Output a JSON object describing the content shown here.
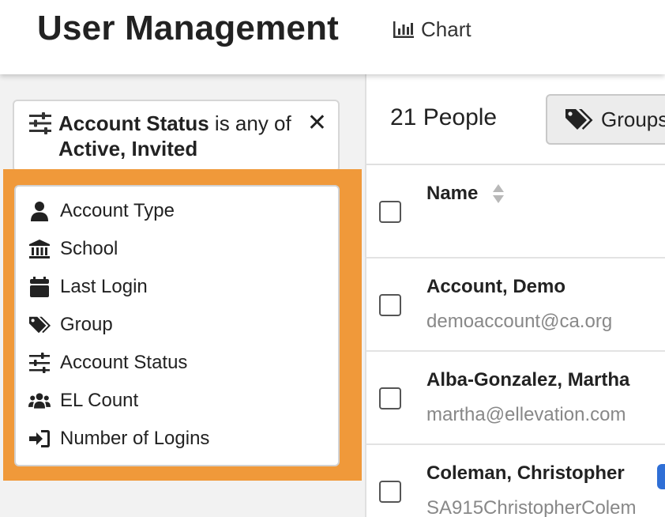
{
  "header": {
    "title": "User Management",
    "chart_label": "Chart"
  },
  "filter": {
    "field": "Account Status",
    "operator": " is any of",
    "values": "Active, Invited",
    "close_glyph": "✕"
  },
  "menu": {
    "items": [
      {
        "label": "Account Type",
        "icon": "user-icon"
      },
      {
        "label": "School",
        "icon": "school-icon"
      },
      {
        "label": "Last Login",
        "icon": "calendar-icon"
      },
      {
        "label": "Group",
        "icon": "tags-icon"
      },
      {
        "label": "Account Status",
        "icon": "sliders-icon"
      },
      {
        "label": "EL Count",
        "icon": "users-icon"
      },
      {
        "label": "Number of Logins",
        "icon": "sign-in-icon"
      }
    ]
  },
  "people": {
    "count_label": "21 People",
    "groups_label": "Groups",
    "name_header": "Name",
    "rows": [
      {
        "name": "Account, Demo",
        "email": "demoaccount@ca.org"
      },
      {
        "name": "Alba-Gonzalez, Martha",
        "email": "martha@ellevation.com"
      },
      {
        "name": "Coleman, Christopher",
        "email": "SA915ChristopherColem"
      }
    ]
  },
  "colors": {
    "highlight": "#f0993a",
    "badge": "#2f6fd6"
  }
}
